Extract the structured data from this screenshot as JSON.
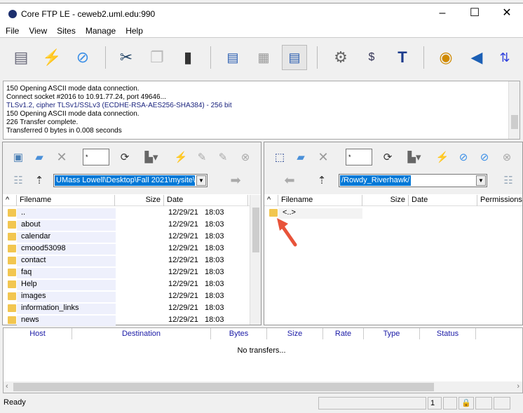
{
  "window": {
    "title": "Core FTP LE - ceweb2.uml.edu:990",
    "minimize": "–",
    "maximize": "☐",
    "close": "✕"
  },
  "menu": [
    "File",
    "View",
    "Sites",
    "Manage",
    "Help"
  ],
  "log": [
    "150 Opening ASCII mode data connection.",
    "Connect socket #2016 to 10.91.77.24, port 49646...",
    "TLSv1.2, cipher TLSv1/SSLv3 (ECDHE-RSA-AES256-SHA384) - 256 bit",
    "150 Opening ASCII mode data connection.",
    "226 Transfer complete.",
    "Transferred 0 bytes in 0.008 seconds"
  ],
  "left": {
    "filter": "*",
    "path": "UMass Lowell\\Desktop\\Fall 2021\\mysite\\",
    "columns": [
      "^",
      "Filename",
      "Size",
      "Date"
    ],
    "files": [
      {
        "name": "..",
        "date": "12/29/21",
        "time": "18:03"
      },
      {
        "name": "about",
        "date": "12/29/21",
        "time": "18:03"
      },
      {
        "name": "calendar",
        "date": "12/29/21",
        "time": "18:03"
      },
      {
        "name": "cmood53098",
        "date": "12/29/21",
        "time": "18:03"
      },
      {
        "name": "contact",
        "date": "12/29/21",
        "time": "18:03"
      },
      {
        "name": "faq",
        "date": "12/29/21",
        "time": "18:03"
      },
      {
        "name": "Help",
        "date": "12/29/21",
        "time": "18:03"
      },
      {
        "name": "images",
        "date": "12/29/21",
        "time": "18:03"
      },
      {
        "name": "information_links",
        "date": "12/29/21",
        "time": "18:03"
      },
      {
        "name": "news",
        "date": "12/29/21",
        "time": "18:03"
      }
    ]
  },
  "right": {
    "filter": "*",
    "path": "/Rowdy_Riverhawk/",
    "columns": [
      "^",
      "Filename",
      "Size",
      "Date",
      "Permissions"
    ],
    "files": [
      {
        "name": "<..>"
      }
    ]
  },
  "transfers": {
    "columns": [
      "Host",
      "Destination",
      "Bytes",
      "Size",
      "Rate",
      "Type",
      "Status"
    ],
    "empty": "No transfers..."
  },
  "status": {
    "text": "Ready",
    "count": "1"
  }
}
